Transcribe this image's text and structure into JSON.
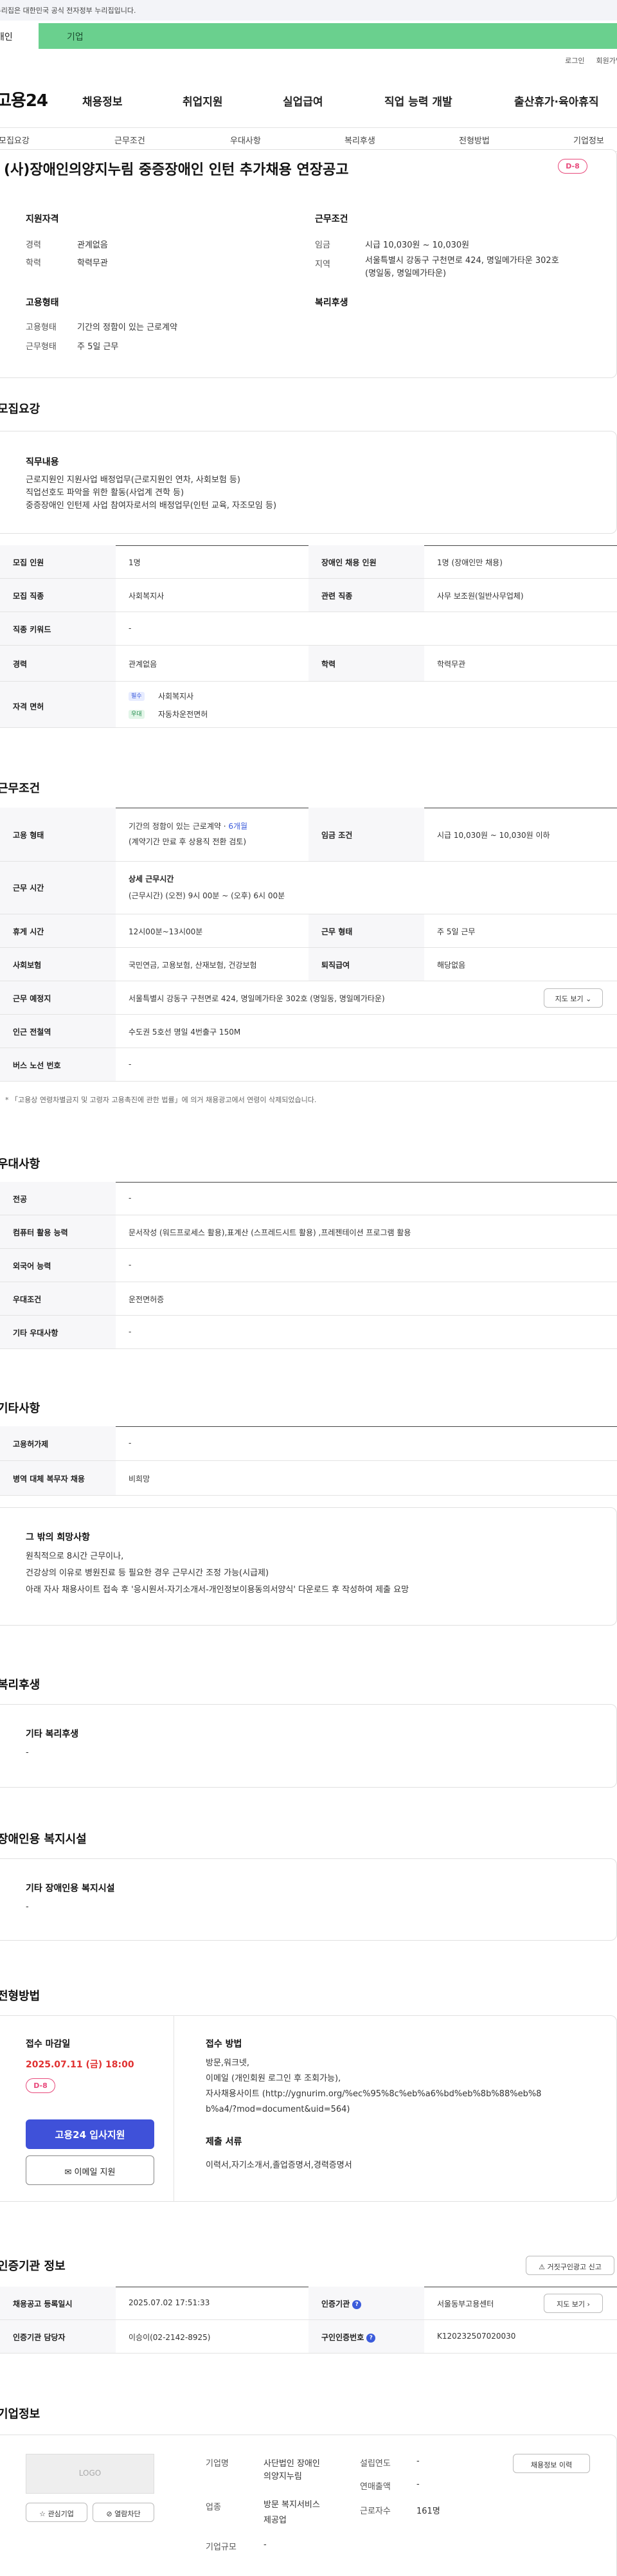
{
  "gov_banner": "이 누리집은 대한민국 공식 전자정부 누리집입니다.",
  "user_tabs": [
    "개인",
    "기업"
  ],
  "top_links": [
    "로그인",
    "회원가입"
  ],
  "site_logo": "고용24",
  "gnb": [
    "채용정보",
    "취업지원",
    "실업급여",
    "직업 능력 개발",
    "출산휴가·육아휴직"
  ],
  "subtabs": [
    "모집요강",
    "근무조건",
    "우대사항",
    "복리후생",
    "전형방법",
    "기업정보"
  ],
  "job": {
    "title": "(사)장애인의양지누림 중증장애인 인턴 추가채용 연장공고",
    "dday": "D-8",
    "qual_h": "지원자격",
    "career_l": "경력",
    "career_v": "관계없음",
    "edu_l": "학력",
    "edu_v": "학력무관",
    "cond_h": "근무조건",
    "wage_l": "임금",
    "wage_v": "시급 10,030원 ~ 10,030원",
    "area_l": "지역",
    "area_v1": "서울특별시 강동구 구천면로 424, 명일메가타운 302호",
    "area_v2": "(명일동, 명일메가타운)",
    "emp_h": "고용형태",
    "emptype_l": "고용형태",
    "emptype_v": "기간의 정함이 있는 근로계약",
    "worktype_l": "근무형태",
    "worktype_v": "주 5일 근무",
    "welfare_h": "복리후생"
  },
  "recruit": {
    "heading": "모집요강",
    "duty_h": "직무내용",
    "duty_lines": [
      "근로지원인 지원사업 배정업무(근로지원인 연차, 사회보험 등)",
      "직업선호도 파악을 위한 활동(사업계 견학 등)",
      "중증장애인 인턴제 사업 참여자로서의 배정업무(인턴 교육, 자조모임 등)"
    ],
    "count_l": "모집 인원",
    "count_v": "1명",
    "dis_l": "장애인 채용 인원",
    "dis_v": "1명 (장애인만 채용)",
    "job_l": "모집 직종",
    "job_v": "사회복지사",
    "rel_l": "관련 직종",
    "rel_v": "사무 보조원(일반사무업체)",
    "kw_l": "직종 키워드",
    "kw_v": "-",
    "career_l": "경력",
    "career_v": "관계없음",
    "edu_l": "학력",
    "edu_v": "학력무관",
    "lic_l": "자격 면허",
    "lic1_badge": "필수",
    "lic1": "사회복지사",
    "lic2_badge": "우대",
    "lic2": "자동차운전면허"
  },
  "work": {
    "heading": "근무조건",
    "emp_l": "고용 형태",
    "emp_v": "기간의 정함이 있는 근로계약 · ",
    "emp_v_months": "6개월",
    "emp_v2": "(계약기간 만료 후 상용직 전환 검토)",
    "wage_l": "임금 조건",
    "wage_v": "시급 10,030원 ~ 10,030원 이하",
    "time_l": "근무 시간",
    "time_h": "상세 근무시간",
    "time_v": "(근무시간) (오전) 9시 00분 ~ (오후) 6시 00분",
    "rest_l": "휴게 시간",
    "rest_v": "12시00분~13시00분",
    "form_l": "근무 형태",
    "form_v": "주 5일 근무",
    "ins_l": "사회보험",
    "ins_v": "국민연금, 고용보험, 산재보험, 건강보험",
    "ret_l": "퇴직급여",
    "ret_v": "해당없음",
    "loc_l": "근무 예정지",
    "loc_v": "서울특별시 강동구 구천면로 424, 명일메가타운 302호 (명일동, 명일메가타운)",
    "map_btn": "지도 보기",
    "sub_l": "인근 전철역",
    "sub_v": "수도권 5호선 명일 4번출구 150M",
    "bus_l": "버스 노선 번호",
    "bus_v": "-",
    "note": "* 「고용상 연령차별금지 및 고령자 고용촉진에 관한 법률」에 의거 채용광고에서 연령이 삭제되었습니다."
  },
  "pref": {
    "heading": "우대사항",
    "major_l": "전공",
    "major_v": "-",
    "pc_l": "컴퓨터 활용 능력",
    "pc_v": "문서작성 (워드프로세스 활용),표계산 (스프레드시트 활용) ,프레젠테이션 프로그램 활용",
    "lang_l": "외국어 능력",
    "lang_v": "-",
    "cond_l": "우대조건",
    "cond_v": "운전면허증",
    "etc_l": "기타 우대사항",
    "etc_v": "-"
  },
  "other": {
    "heading": "기타사항",
    "sup_l": "고용허가제",
    "sup_v": "-",
    "mil_l": "병역 대체 복무자 채용",
    "mil_v": "비희망",
    "wish_h": "그 밖의 희망사항",
    "wish_lines": [
      "원칙적으로 8시간 근무이나,",
      "건강상의 이유로 병원진료 등 필요한 경우 근무시간 조정 가능(시급제)",
      "아래 자사 채용사이트 접속 후 '응시원서-자기소개서-개인정보이용동의서양식' 다운로드 후 작성하여 제출 요망"
    ]
  },
  "welfare": {
    "heading": "복리후생",
    "h": "기타 복리후생",
    "v": "-"
  },
  "disability": {
    "heading": "장애인용 복지시설",
    "h": "기타 장애인용 복지시설",
    "v": "-"
  },
  "screen": {
    "heading": "전형방법",
    "deadline_h": "접수 마감일",
    "deadline_v": "2025.07.11 (금) 18:00",
    "dday": "D-8",
    "apply_btn": "고용24 입사지원",
    "mail_btn": "이메일 지원",
    "method_h": "접수 방법",
    "method_lines": [
      "방문,워크넷,",
      "이메일 (개인회원 로그인 후 조회가능),",
      "자사채용사이트 (http://ygnurim.org/%ec%95%8c%eb%a6%bd%eb%8b%88%eb%8",
      "b%a4/?mod=document&uid=564)"
    ],
    "docs_h": "제출 서류",
    "docs_v": "이력서,자기소개서,졸업증명서,경력증명서"
  },
  "cert": {
    "heading": "인증기관 정보",
    "report_btn": "거짓구인광고 신고",
    "reg_l": "채용공고 등록일시",
    "reg_v": "2025.07.02 17:51:33",
    "org_l": "인증기관",
    "org_v": "서울동부고용센터",
    "map_btn": "지도 보기",
    "mgr_l": "인증기관 담당자",
    "mgr_v": "이승이(02-2142-8925)",
    "no_l": "구인인증번호",
    "no_v": "K120232507020030"
  },
  "company": {
    "heading": "기업정보",
    "logo": "LOGO",
    "fav_btn": "관심기업",
    "block_btn": "열람차단",
    "name_l": "기업명",
    "name_v1": "사단법인 장애인",
    "name_v2": "의양지누림",
    "year_l": "설립연도",
    "year_v": "-",
    "sales_l": "연매출액",
    "sales_v": "-",
    "ind_l": "업종",
    "ind_v1": "방문 복지서비스",
    "ind_v2": "제공업",
    "emp_l": "근로자수",
    "emp_v": "161명",
    "size_l": "기업규모",
    "size_v": "-",
    "more_btn": "채용정보 이력"
  }
}
